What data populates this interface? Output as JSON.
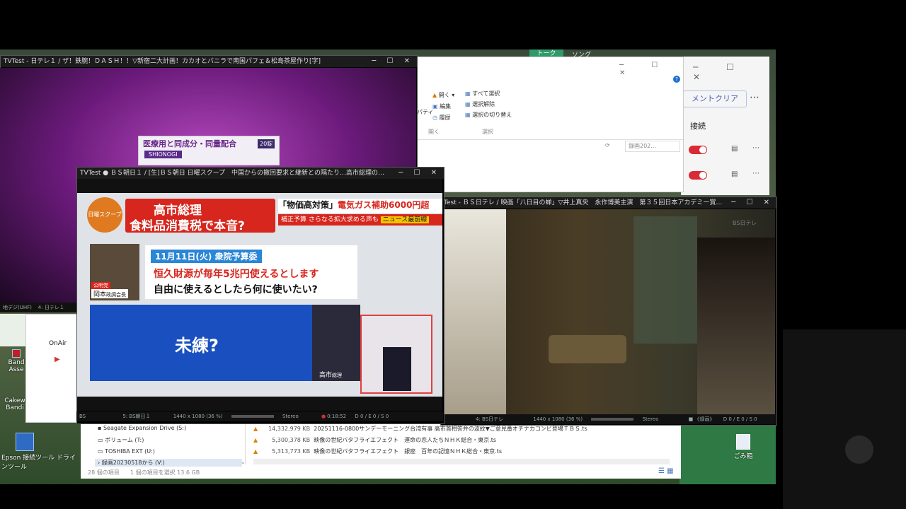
{
  "win_tvtest1": {
    "title": "TVTest - 日テレ１ / ザ！鉄腕！ＤＡＳＨ！！▽新宿二大計画！カカオとバニラで南国パフェ＆松島茶屋作り[字]",
    "ad_text": "医療用と同成分・同量配合",
    "ad_count": "20錠",
    "ad_brand": "SHIONOGI",
    "status_left": "地デジ(UHF)",
    "status_channel": "4: 日テレ１"
  },
  "win_tvtest2": {
    "title": "TVTest ● ＢＳ朝日１ / [生]ＢＳ朝日 日曜スクープ　中国からの撤回要求と継新との隔たり…高市総理の…",
    "logo": "日曜スクープ",
    "headline1": "高市総理",
    "headline2": "食料品消費税で本音?",
    "tag1": "「物価高対策」",
    "tag1b": "電気ガス補助6000円超",
    "tag2": "補正予算 さらなる拡大求める声も",
    "tag2b": "ニュース最前線",
    "date_label": "11月11日(火) 衆院予算委",
    "quote1": "恒久財源が毎年5兆円使えるとします",
    "quote2": "自由に使えるとしたら何に使いたい?",
    "speaker_party": "公明党",
    "speaker_name": "岡本",
    "speaker_title": "政調会長",
    "caption": "未練?",
    "pm_label": "高市",
    "pm_title": "総理",
    "status": {
      "src": "BS",
      "channel": "5: BS朝日１",
      "res": "1440 x 1080 (36 %)",
      "audio": "Stereo",
      "time": "0:18:52",
      "drops": "D 0 / E 0 / S 0"
    }
  },
  "win_tvtest3": {
    "title": "Test - ＢＳ日テレ / 映画「八日目の蝉」▽井上真央　永作博美主演　第３５回日本アカデミー賞…",
    "watermark": "BS日テレ",
    "status": {
      "channel": "4: BS日テレ",
      "res": "1440 x 1080 (36 %)",
      "audio": "Stereo",
      "rec": "■ 《録画》",
      "drops": "D 0 / E 0 / S 0"
    }
  },
  "explorer": {
    "open_label": "開く",
    "edit_label": "編集",
    "history_label": "履歴",
    "open_group": "開く",
    "select_all": "すべて選択",
    "select_none": "選択解除",
    "select_invert": "選択の切り替え",
    "select_group": "選択",
    "properties": "パティ",
    "search_placeholder": "録画202...",
    "drives": [
      "Seagate Expansion Drive (S:)",
      "ボリューム (T:)",
      "TOSHIBA EXT (U:)",
      "録画20230518から (V:)"
    ],
    "files": [
      {
        "size": "14,332,979 KB",
        "name": "20251116-0800サンデーモーニング台湾有事 高市首相答弁の波紋▼ご意見番オチナカコンビ登場ＴＢＳ.ts"
      },
      {
        "size": "5,300,378 KB",
        "name": "映像の世紀バタフライエフェクト　運命の恋人たちＮＨＫ総合・東京.ts"
      },
      {
        "size": "5,313,773 KB",
        "name": "映像の世紀バタフライエフェクト　銀座　百年の記憶ＮＨＫ総合・東京.ts"
      }
    ],
    "status_count": "28 個の項目",
    "status_selected": "1 個の項目を選択  13.6 GB"
  },
  "teams": {
    "tab1": "トーク",
    "tab2": "ソング",
    "clear_button": "メントクリア",
    "section": "接続"
  },
  "onair": {
    "label": "OnAir"
  },
  "desktop": {
    "icons": [
      "Band Asse",
      "Cakew Bandi",
      "Epson 接続ツール ドライ ンツール"
    ],
    "recycle": "ごみ箱"
  }
}
